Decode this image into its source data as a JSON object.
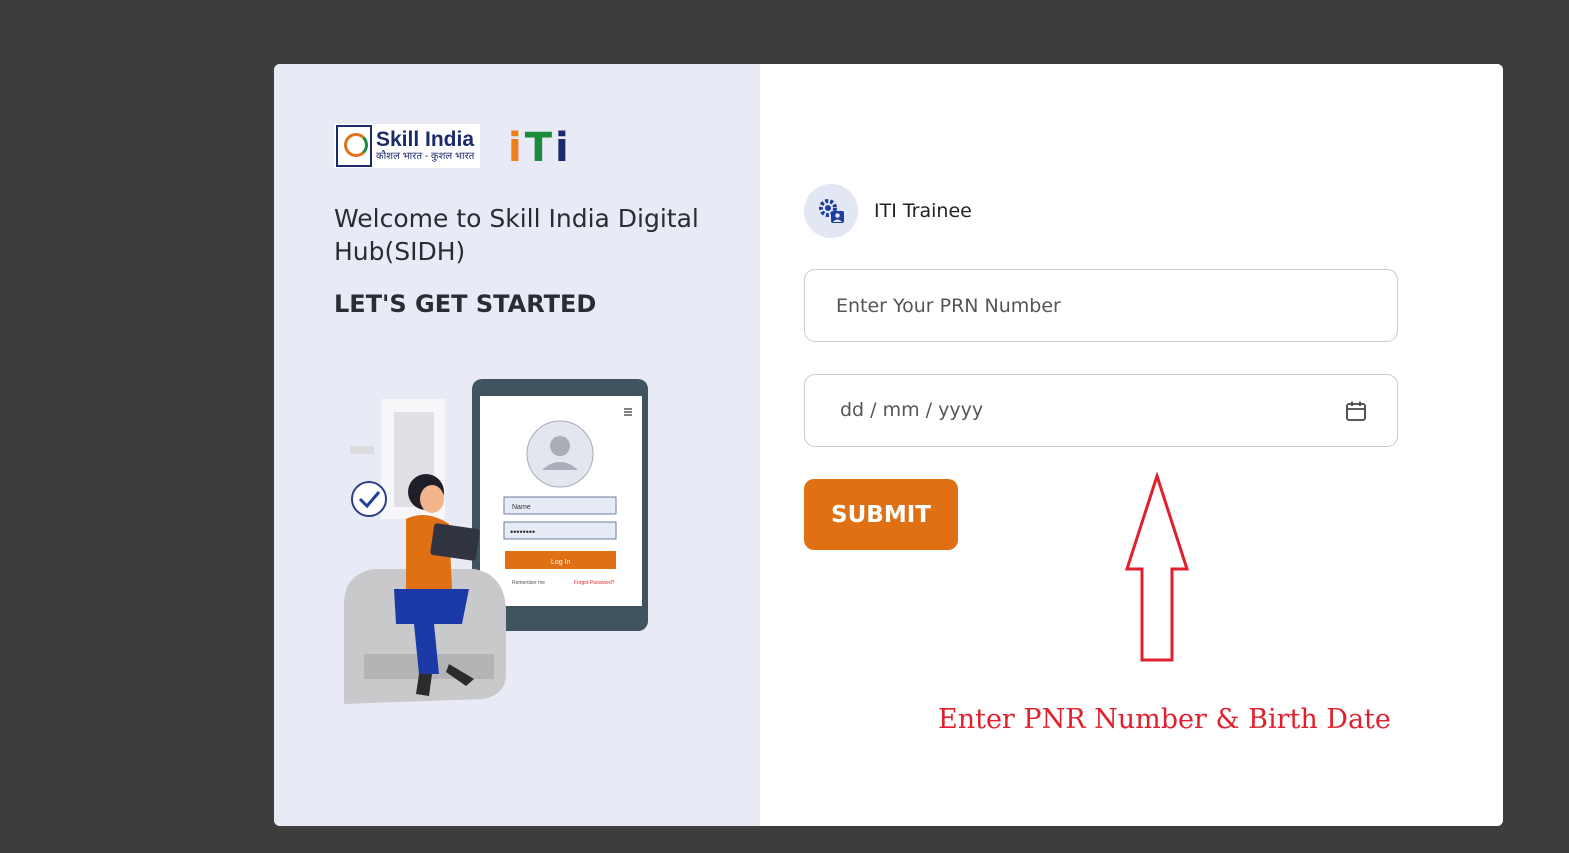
{
  "branding": {
    "skill_india_title": "Skill India",
    "skill_india_tagline": "कौशल भारत - कुशल भारत",
    "iti_letters": [
      "i",
      "T",
      "i"
    ],
    "iti_colors": [
      "#ef7d1a",
      "#1a8a3c",
      "#1b2a6b"
    ]
  },
  "left_panel": {
    "welcome_text": "Welcome to Skill India Digital Hub(SIDH)",
    "cta_text": "LET'S GET STARTED",
    "illustration": {
      "name_label": "Name",
      "password_dots": "••••••••",
      "login_label": "Log In",
      "remember_label": "Remember me",
      "forgot_label": "Forgot Password?"
    }
  },
  "form": {
    "role_label": "ITI Trainee",
    "prn_placeholder": "Enter Your PRN Number",
    "dob_placeholder": "dd / mm / yyyy",
    "submit_label": "SUBMIT"
  },
  "annotation": {
    "note_text": "Enter PNR Number & Birth Date",
    "color": "#e0202c"
  },
  "colors": {
    "accent": "#e07014",
    "left_bg": "#e8ebf6",
    "page_bg": "#3d3d3d",
    "brand_blue": "#1b2a6b"
  }
}
